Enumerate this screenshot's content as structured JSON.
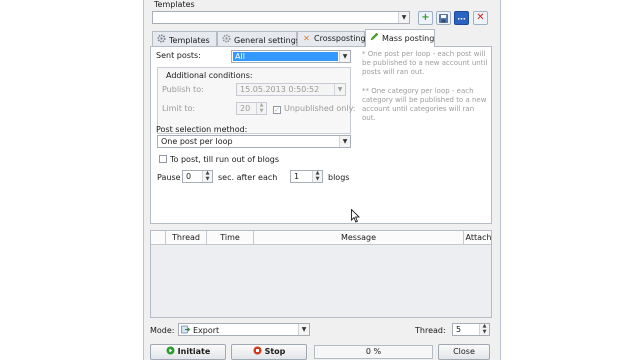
{
  "templates": {
    "label": "Templates",
    "value": "",
    "buttons": [
      {
        "name": "add",
        "glyph": "+",
        "color": "#2e9b2e"
      },
      {
        "name": "save",
        "glyph": "▪",
        "color": "#3a5f9a"
      },
      {
        "name": "edit",
        "glyph": "…",
        "color": "#2b63c2"
      },
      {
        "name": "delete",
        "glyph": "✕",
        "color": "#d02020"
      }
    ]
  },
  "tabs": [
    {
      "label": "Templates",
      "icon": "gear-icon",
      "active": false
    },
    {
      "label": "General settings",
      "icon": "gear-icon",
      "active": false
    },
    {
      "label": "Crossposting",
      "icon": "cross-icon",
      "active": false
    },
    {
      "label": "Mass posting",
      "icon": "pencil-icon",
      "active": true
    }
  ],
  "mass_posting": {
    "sent_posts_label": "Sent posts:",
    "sent_posts_value": "All",
    "additional_conditions": "Additional conditions:",
    "publish_to_label": "Publish to:",
    "publish_to_value": "15.05.2013 0:50:52",
    "limit_to_label": "Limit to:",
    "limit_to_value": "20",
    "unpublished_only_label": "Unpublished only:",
    "hint_one_post": "* One post per loop - each post will be published to a new account until posts will ran out.",
    "hint_one_category": "** One category per loop - each category will be published to a new account until categories will ran out.",
    "post_selection_label": "Post selection method:",
    "post_selection_value": "One post per loop",
    "to_post_label": "To post, till run out of blogs",
    "pause_label": "Pause",
    "pause_value": "0",
    "sec_after_label": "sec. after each",
    "blogs_value": "1",
    "blogs_label": "blogs"
  },
  "grid": {
    "columns": [
      "Thread",
      "Time",
      "Message",
      "Attach"
    ]
  },
  "footer": {
    "mode_label": "Mode:",
    "mode_value": "Export",
    "thread_label": "Thread:",
    "thread_value": "5",
    "initiate_label": "Initiate",
    "stop_label": "Stop",
    "progress_text": "0 %",
    "progress_fraction": 0,
    "close_label": "Close"
  },
  "colors": {
    "selection": "#3399ff",
    "initiate_icon": "#2e9b2e",
    "stop_icon": "#d03a1a"
  }
}
